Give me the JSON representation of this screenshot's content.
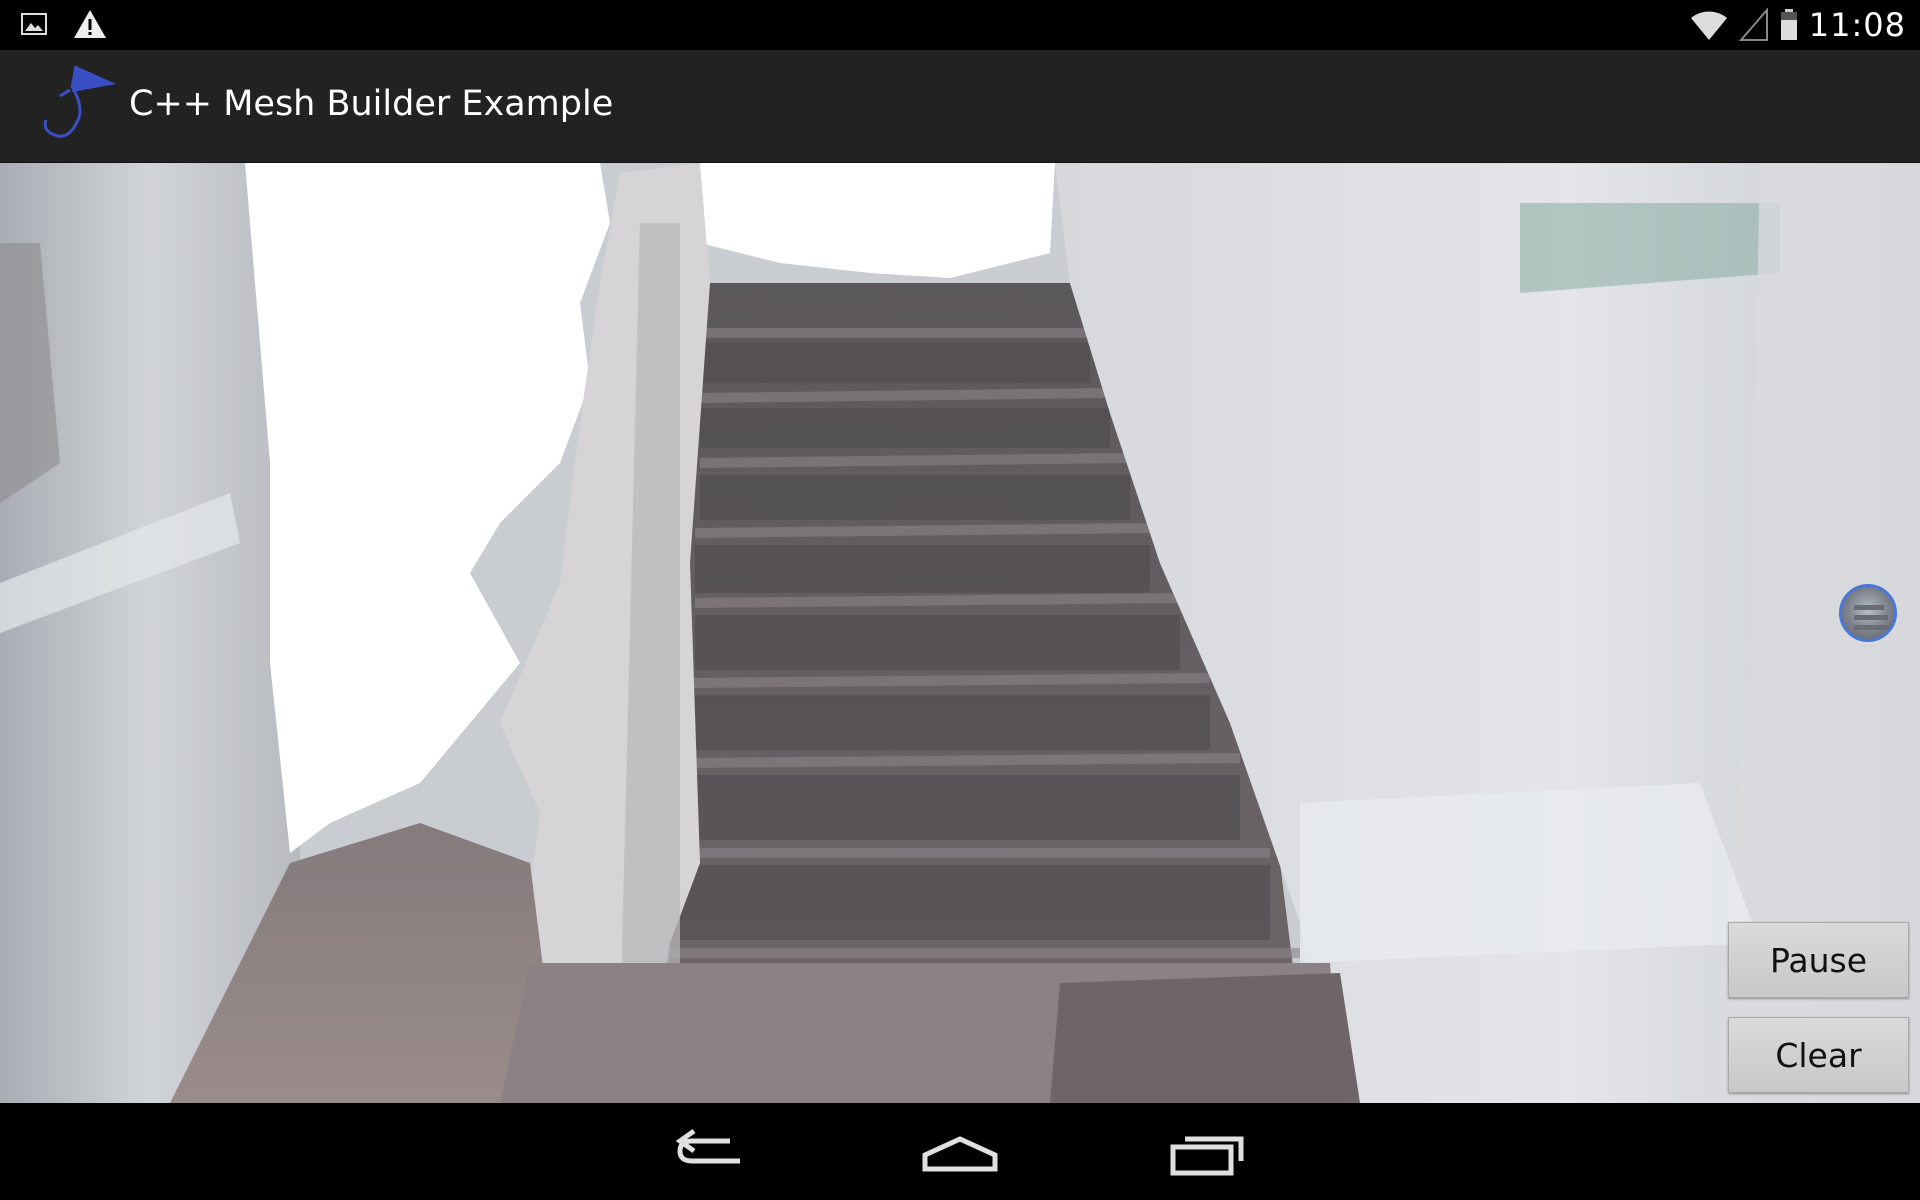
{
  "status_bar": {
    "time": "11:08",
    "left_icons": [
      "image-notification-icon",
      "warning-icon"
    ],
    "right_icons": [
      "wifi-icon",
      "cell-signal-icon",
      "battery-icon"
    ]
  },
  "action_bar": {
    "title": "C++ Mesh Builder Example",
    "icon": "tango-kite-flag-icon"
  },
  "scene": {
    "description_icon": "mesh-viewport"
  },
  "controls": {
    "pause_label": "Pause",
    "clear_label": "Clear",
    "camera_thumbnail_icon": "camera-preview-thumbnail"
  },
  "nav_bar": {
    "icons": [
      "back-icon",
      "home-icon",
      "recent-apps-icon"
    ]
  },
  "colors": {
    "status_bar_bg": "#000000",
    "action_bar_bg": "#222222",
    "accent": "#3b4fc4",
    "button_bg": "#d2d3d5"
  }
}
